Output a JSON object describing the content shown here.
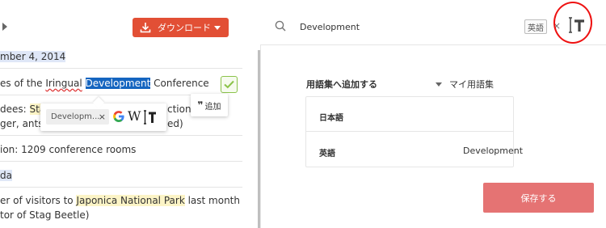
{
  "document": {
    "download_label": "ダウンロード",
    "date_line": "mber 4, 2014",
    "title_line": {
      "prefix": "es of the ",
      "misspelled": "Iringual",
      "space": " ",
      "selected": "Development",
      "suffix": " Conference"
    },
    "attendees_line1": {
      "prefix": "dees: ",
      "highlight": "Sta",
      "suffix": "ction"
    },
    "attendees_line2": {
      "prefix": "ger, ants,",
      "suffix": "ed)"
    },
    "location_line": "ion: 1209 conference rooms",
    "agenda_line": "da",
    "visitors_line": {
      "prefix": "er of visitors to ",
      "highlight": "Japonica National Park",
      "suffix": " last month"
    },
    "director_line": "tor of Stag Beetle)",
    "add_tag_label": "追加",
    "popup": {
      "chip_text": "Developm...",
      "close": "×",
      "g_icon": "google-icon",
      "w_label": "W"
    }
  },
  "dictionary": {
    "search_value": "Development",
    "lang_badge": "英語",
    "close": "×",
    "add_to_wordbook_label": "用語集へ追加する",
    "wordbook_name": "マイ用語集",
    "rows": [
      {
        "key": "日本語",
        "value": ""
      },
      {
        "key": "英語",
        "value": "Development"
      }
    ],
    "save_label": "保存する"
  },
  "colors": {
    "download": "#e24f35",
    "selection": "#1565c0",
    "save": "#e57373",
    "annotation_circle": "#e11111",
    "check": "#8bc34a"
  }
}
